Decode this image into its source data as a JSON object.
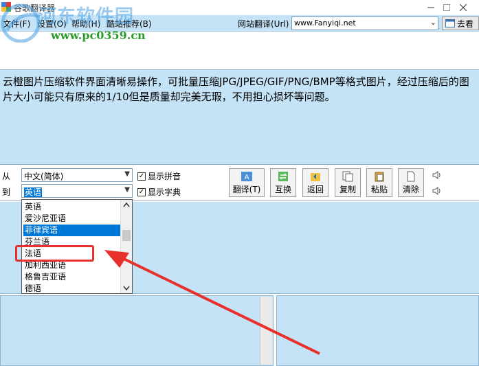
{
  "window": {
    "title": "谷歌翻译器"
  },
  "watermark": {
    "title": "河东软件园",
    "url": "www.pc0359.cn"
  },
  "menu": {
    "items": [
      "文件(F)",
      "设置(O)",
      "帮助(H)",
      "酷站推荐(B)"
    ],
    "url_label": "网站翻译(Url)",
    "url_value": "www.Fanyiqi.net",
    "go_label": "去看"
  },
  "source_text": "云橙图片压缩软件界面清晰易操作，可批量压缩JPG/JPEG/GIF/PNG/BMP等格式图片，经过压缩后的图片大小可能只有原来的1/10但是质量却完美无瑕，不用担心损坏等问题。",
  "controls": {
    "from_label": "从",
    "to_label": "到",
    "from_value": "中文(简体)",
    "to_value": "英语",
    "show_pinyin": "显示拼音",
    "show_dict": "显示字典",
    "buttons": {
      "translate": "翻译(T)",
      "swap": "互换",
      "back": "返回",
      "copy": "复制",
      "paste": "粘贴",
      "clear": "清除"
    }
  },
  "dropdown": {
    "options": [
      "英语",
      "爱沙尼亚语",
      "菲律宾语",
      "芬兰语",
      "法语",
      "加利西亚语",
      "格鲁吉亚语",
      "德语"
    ],
    "selected_index": 2
  },
  "colors": {
    "panel": "#c5e3f6",
    "selection": "#0078d7",
    "annotation": "#e8312b"
  }
}
